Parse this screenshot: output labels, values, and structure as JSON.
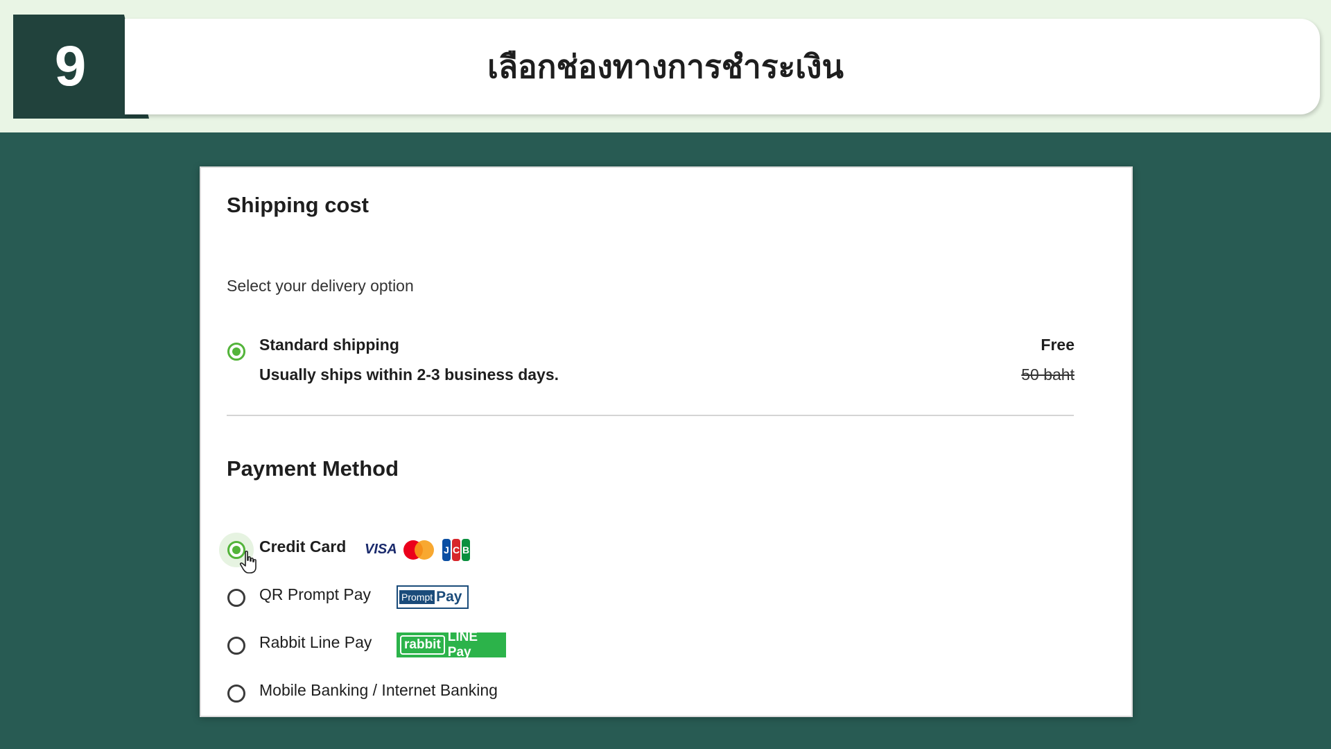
{
  "banner": {
    "step_number": "9",
    "title": "เลือกช่องทางการชำระเงิน"
  },
  "shipping": {
    "heading": "Shipping cost",
    "subheading": "Select your delivery option",
    "option": {
      "name": "Standard shipping",
      "description": "Usually ships within 2-3 business days.",
      "price": "Free",
      "original_price": "50 baht",
      "selected": true
    }
  },
  "payment": {
    "heading": "Payment Method",
    "methods": [
      {
        "label": "Credit Card",
        "selected": true,
        "logos": [
          "VISA",
          "mastercard-logo",
          "JCB"
        ]
      },
      {
        "label": "QR Prompt Pay",
        "selected": false,
        "logo_text": [
          "Prompt",
          "Pay"
        ]
      },
      {
        "label": "Rabbit Line Pay",
        "selected": false,
        "logo_text": [
          "rabbit",
          "LINE Pay"
        ]
      },
      {
        "label": "Mobile Banking / Internet Banking",
        "selected": false
      }
    ]
  },
  "colors": {
    "background": "#285b53",
    "banner_band": "#e9f5e5",
    "step_block": "#21423c",
    "radio_selected": "#53b43a"
  }
}
